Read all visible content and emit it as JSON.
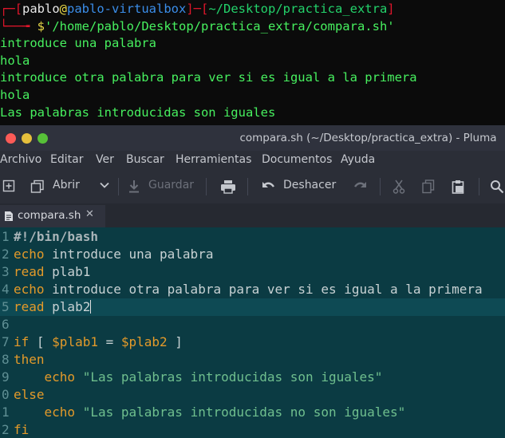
{
  "terminal": {
    "prompt_open": "┌─[",
    "user": "pablo",
    "at": "@",
    "host": "pablo-virtualbox",
    "prompt_mid": "]─[",
    "path": "~/Desktop/practica_extra",
    "prompt_close": "]",
    "prompt_line2_prefix": "└──╼ ",
    "prompt_symbol": "$",
    "command": "'/home/pablo/Desktop/practica_extra/compara.sh'",
    "output": [
      "introduce una palabra",
      "hola",
      "introduce otra palabra para ver si es igual a la primera",
      "hola",
      "Las palabras introducidas son iguales"
    ]
  },
  "window": {
    "title": "compara.sh (~/Desktop/practica_extra) - Pluma",
    "button_colors": {
      "close": "#fc5b57",
      "minimize": "#e5bf3c",
      "maximize": "#57c038"
    }
  },
  "menu": [
    "Archivo",
    "Editar",
    "Ver",
    "Buscar",
    "Herramientas",
    "Documentos",
    "Ayuda"
  ],
  "toolbar": {
    "open_label": "Abrir",
    "save_label": "Guardar",
    "undo_label": "Deshacer"
  },
  "tab": {
    "label": "compara.sh",
    "close_symbol": "✕"
  },
  "editor": {
    "current_line": 5,
    "lines": [
      {
        "num": "1",
        "parts": [
          {
            "t": "#!/bin/bash",
            "c": "cm"
          }
        ]
      },
      {
        "num": "2",
        "parts": [
          {
            "t": "echo",
            "c": "kw"
          },
          {
            "t": " introduce una palabra",
            "c": "tx"
          }
        ]
      },
      {
        "num": "3",
        "parts": [
          {
            "t": "read",
            "c": "kw"
          },
          {
            "t": " plab1",
            "c": "tx"
          }
        ]
      },
      {
        "num": "4",
        "parts": [
          {
            "t": "echo",
            "c": "kw"
          },
          {
            "t": " introduce otra palabra para ver si es igual a la primera",
            "c": "tx"
          }
        ]
      },
      {
        "num": "5",
        "parts": [
          {
            "t": "read",
            "c": "kw"
          },
          {
            "t": " plab2",
            "c": "tx"
          }
        ]
      },
      {
        "num": "6",
        "parts": []
      },
      {
        "num": "7",
        "parts": [
          {
            "t": "if",
            "c": "kw"
          },
          {
            "t": " [ ",
            "c": "tx"
          },
          {
            "t": "$plab1",
            "c": "vr"
          },
          {
            "t": " = ",
            "c": "tx"
          },
          {
            "t": "$plab2",
            "c": "vr"
          },
          {
            "t": " ]",
            "c": "tx"
          }
        ]
      },
      {
        "num": "8",
        "parts": [
          {
            "t": "then",
            "c": "kw"
          }
        ]
      },
      {
        "num": "9",
        "parts": [
          {
            "t": "    ",
            "c": "tx"
          },
          {
            "t": "echo",
            "c": "kw"
          },
          {
            "t": " ",
            "c": "tx"
          },
          {
            "t": "\"Las palabras introducidas son iguales\"",
            "c": "st"
          }
        ]
      },
      {
        "num": "0",
        "parts": [
          {
            "t": "else",
            "c": "kw"
          }
        ]
      },
      {
        "num": "1",
        "parts": [
          {
            "t": "    ",
            "c": "tx"
          },
          {
            "t": "echo",
            "c": "kw"
          },
          {
            "t": " ",
            "c": "tx"
          },
          {
            "t": "\"Las palabras introducidas no son iguales\"",
            "c": "st"
          }
        ]
      },
      {
        "num": "2",
        "parts": [
          {
            "t": "fi",
            "c": "kw"
          }
        ]
      }
    ]
  }
}
